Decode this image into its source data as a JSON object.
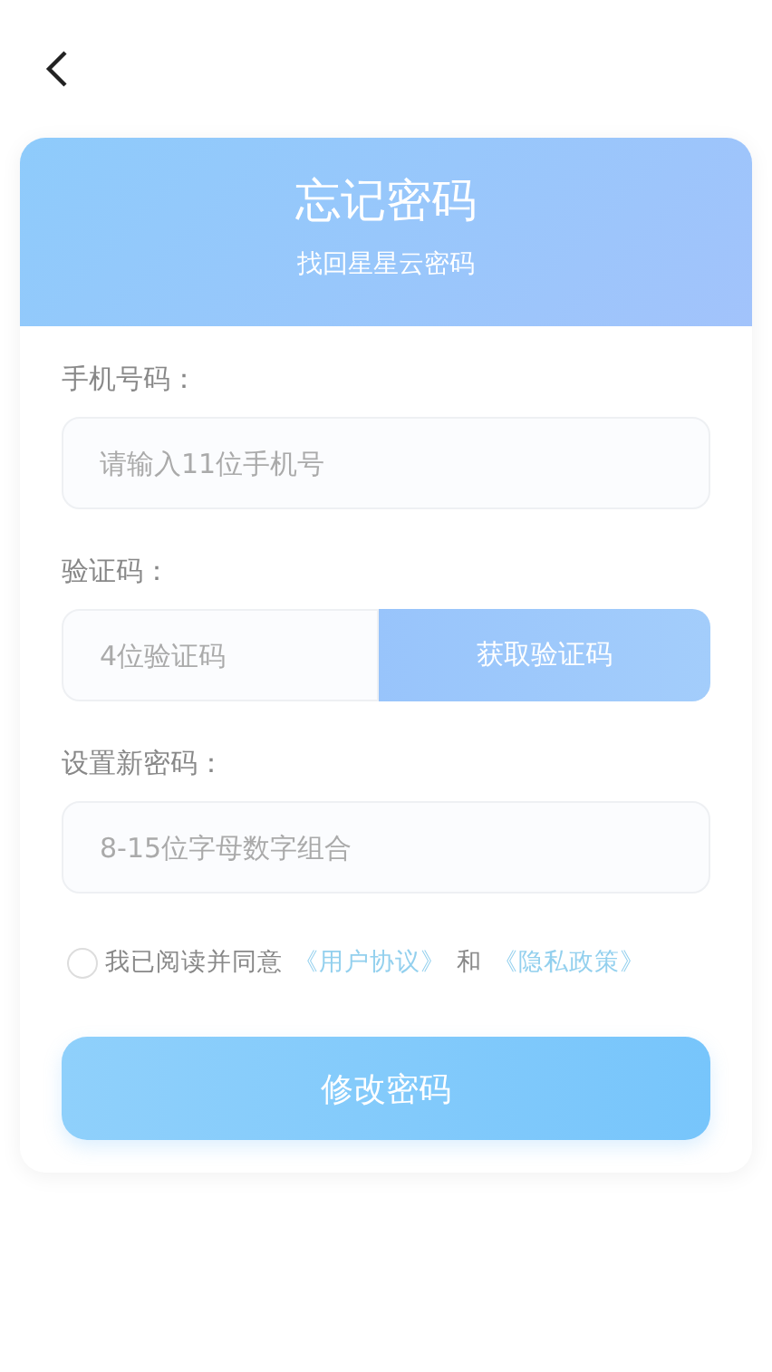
{
  "header": {
    "title": "忘记密码",
    "subtitle": "找回星星云密码"
  },
  "fields": [
    {
      "kind": "text",
      "label": "手机号码：",
      "placeholder": "请输入11位手机号"
    },
    {
      "kind": "code",
      "label": "验证码：",
      "placeholder": "4位验证码",
      "button": "获取验证码"
    },
    {
      "kind": "text",
      "label": "设置新密码：",
      "placeholder": "8-15位字母数字组合"
    }
  ],
  "agreement": {
    "checked": false,
    "parts": [
      {
        "kind": "text",
        "text": "我已阅读并同意"
      },
      {
        "kind": "link",
        "text": "《用户协议》"
      },
      {
        "kind": "text",
        "text": "和"
      },
      {
        "kind": "link",
        "text": "《隐私政策》"
      }
    ]
  },
  "submit": "修改密码"
}
